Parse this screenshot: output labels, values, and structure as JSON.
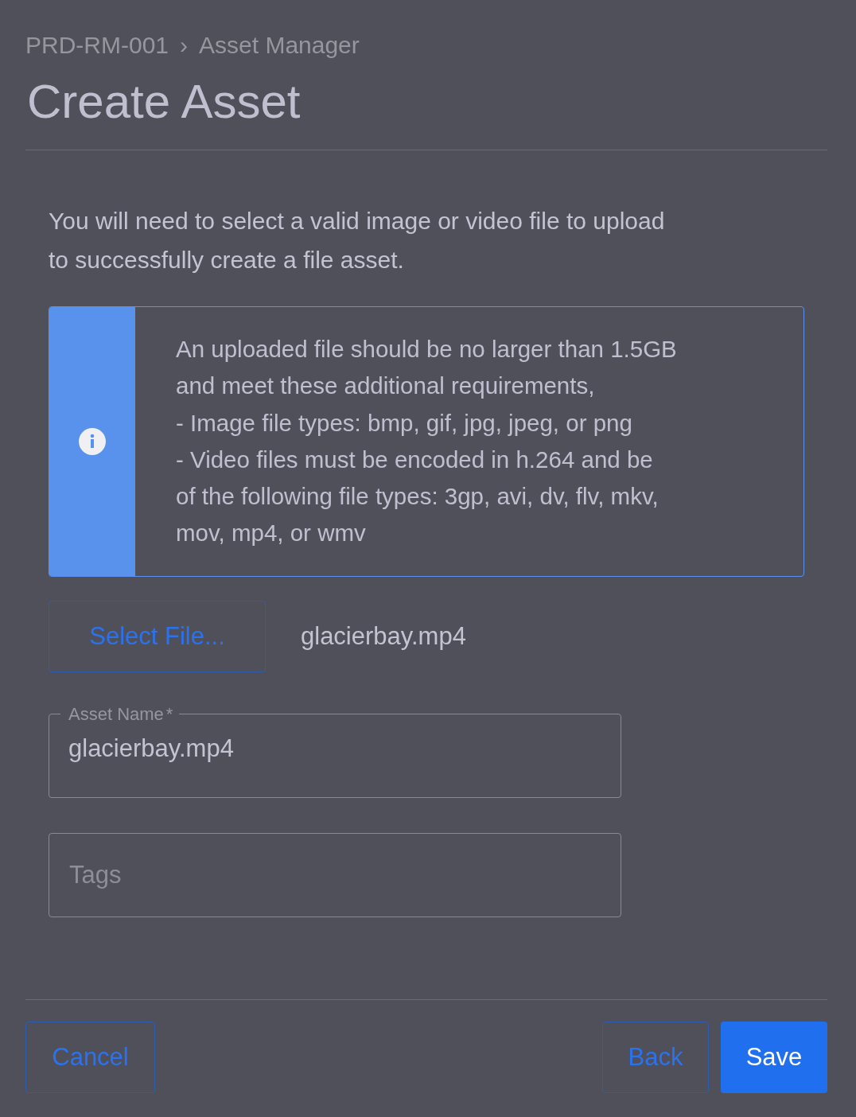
{
  "breadcrumb": {
    "items": [
      "PRD-RM-001",
      "Asset Manager"
    ],
    "separator": "›"
  },
  "title": "Create Asset",
  "intro": "You will need to select a valid image or video file to upload\nto successfully create a file asset.",
  "info": {
    "text": "An uploaded file should be no larger than 1.5GB\nand meet these additional requirements,\n- Image file types: bmp, gif, jpg, jpeg, or png\n- Video files must be encoded in h.264 and be\nof the following file types: 3gp, avi, dv, flv, mkv,\nmov, mp4, or wmv"
  },
  "file": {
    "button": "Select File...",
    "name": "glacierbay.mp4"
  },
  "asset_name": {
    "label": "Asset Name",
    "required_mark": "*",
    "value": "glacierbay.mp4"
  },
  "tags": {
    "placeholder": "Tags"
  },
  "footer": {
    "cancel": "Cancel",
    "back": "Back",
    "save": "Save"
  }
}
